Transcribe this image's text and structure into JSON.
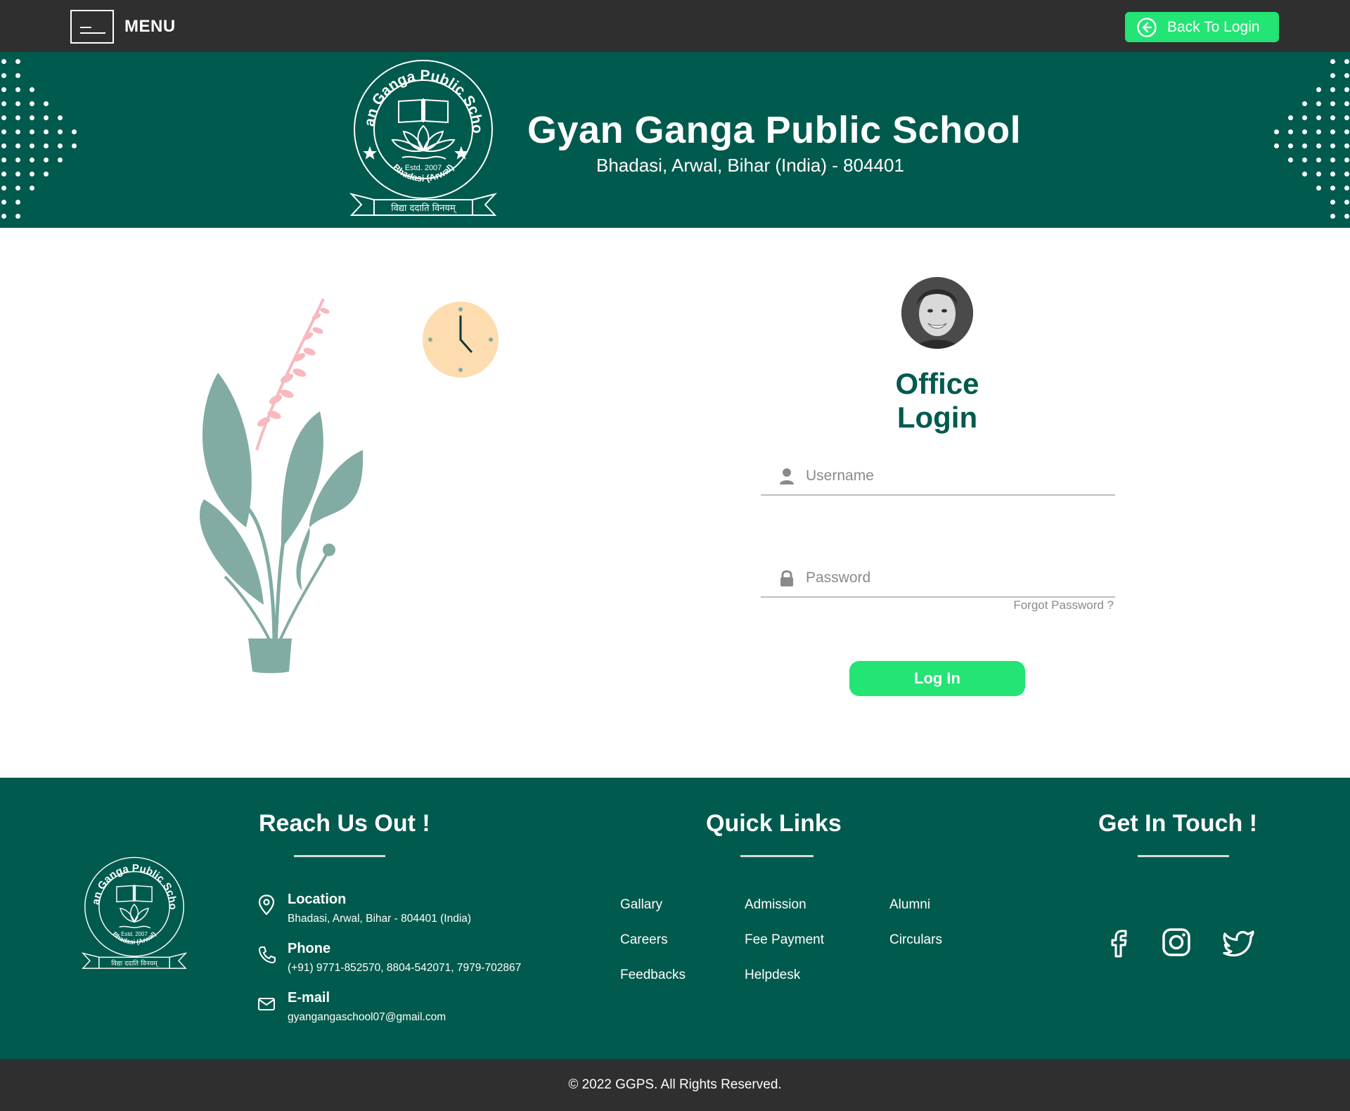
{
  "topbar": {
    "menu_label": "MENU",
    "back_label": "Back To Login"
  },
  "header": {
    "logo_text": {
      "ring": "Gyan Ganga Public School",
      "estd": "Estd. 2007",
      "place": "Bhadasi (Arwal)",
      "motto": "विद्या ददाति विनयम्"
    },
    "school_name": "Gyan Ganga Public School",
    "address": "Bhadasi, Arwal, Bihar (India) - 804401"
  },
  "login": {
    "title": "Office Login",
    "username_placeholder": "Username",
    "password_placeholder": "Password",
    "forgot_label": "Forgot Password ?",
    "submit_label": "Log In"
  },
  "footer": {
    "reach_title": "Reach Us Out !",
    "quick_title": "Quick Links",
    "touch_title": "Get In Touch !",
    "contacts": [
      {
        "title": "Location",
        "text": "Bhadasi, Arwal, Bihar - 804401 (India)",
        "icon": "location-pin-icon"
      },
      {
        "title": "Phone",
        "text": "(+91) 9771-852570, 8804-542071, 7979-702867",
        "icon": "phone-icon"
      },
      {
        "title": "E-mail",
        "text": "gyangangaschool07@gmail.com",
        "icon": "mail-icon"
      }
    ],
    "links": [
      "Gallary",
      "Admission",
      "Alumni",
      "Careers",
      "Fee Payment",
      "Circulars",
      "Feedbacks",
      "Helpdesk"
    ],
    "social": [
      "facebook-icon",
      "instagram-icon",
      "twitter-icon"
    ]
  },
  "copyright": "© 2022 GGPS. All Rights Reserved.",
  "colors": {
    "brand_green": "#005a4d",
    "accent_green": "#23e474",
    "dark_bar": "#2f2f2f",
    "plant": "#82aba3",
    "clock_face": "#fddcb0"
  }
}
